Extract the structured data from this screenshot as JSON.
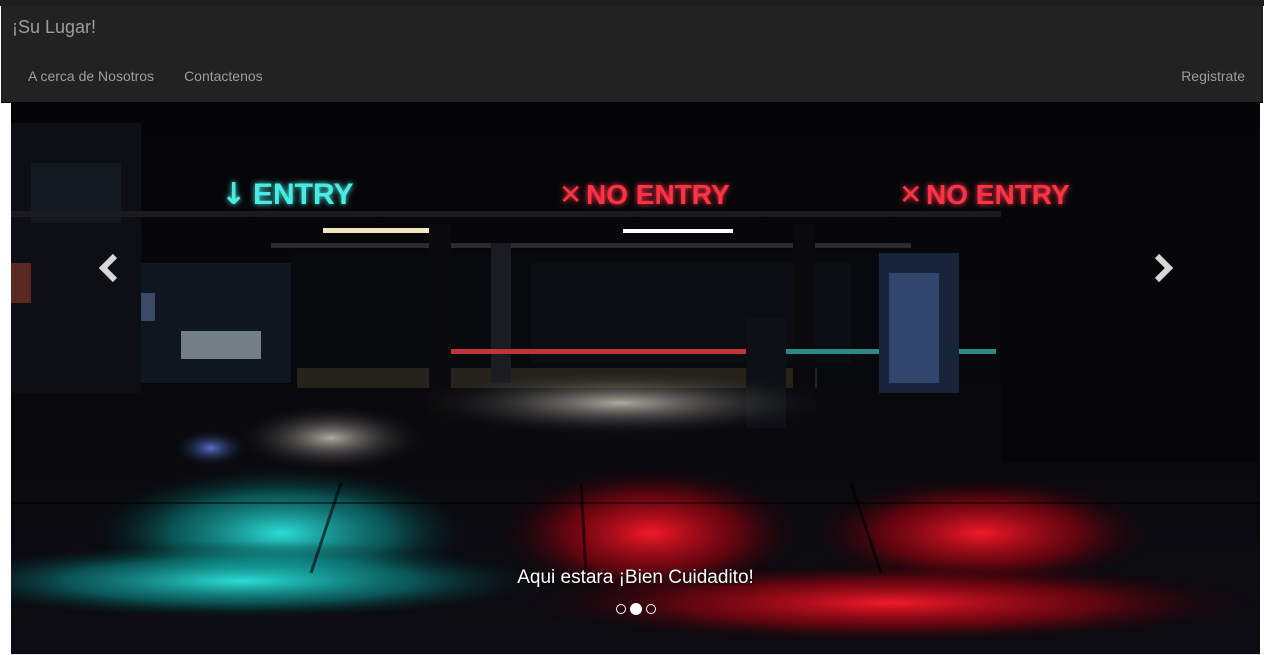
{
  "navbar": {
    "brand": "¡Su Lugar!",
    "links": [
      {
        "label": "A cerca de Nosotros"
      },
      {
        "label": "Contactenos"
      }
    ],
    "right_link": "Registrate"
  },
  "carousel": {
    "signs": {
      "entry": "ENTRY",
      "no_entry_middle": "NO ENTRY",
      "no_entry_right": "NO ENTRY"
    },
    "caption": "Aqui estara ¡Bien Cuidadito!",
    "slide_count": 3,
    "active_index": 1,
    "prev_icon": "chevron-left-icon",
    "next_icon": "chevron-right-icon"
  },
  "colors": {
    "navbar_bg": "#222222",
    "nav_text": "#9d9d9d",
    "entry_sign": "#40e6df",
    "no_entry_sign": "#ff2a3c"
  }
}
